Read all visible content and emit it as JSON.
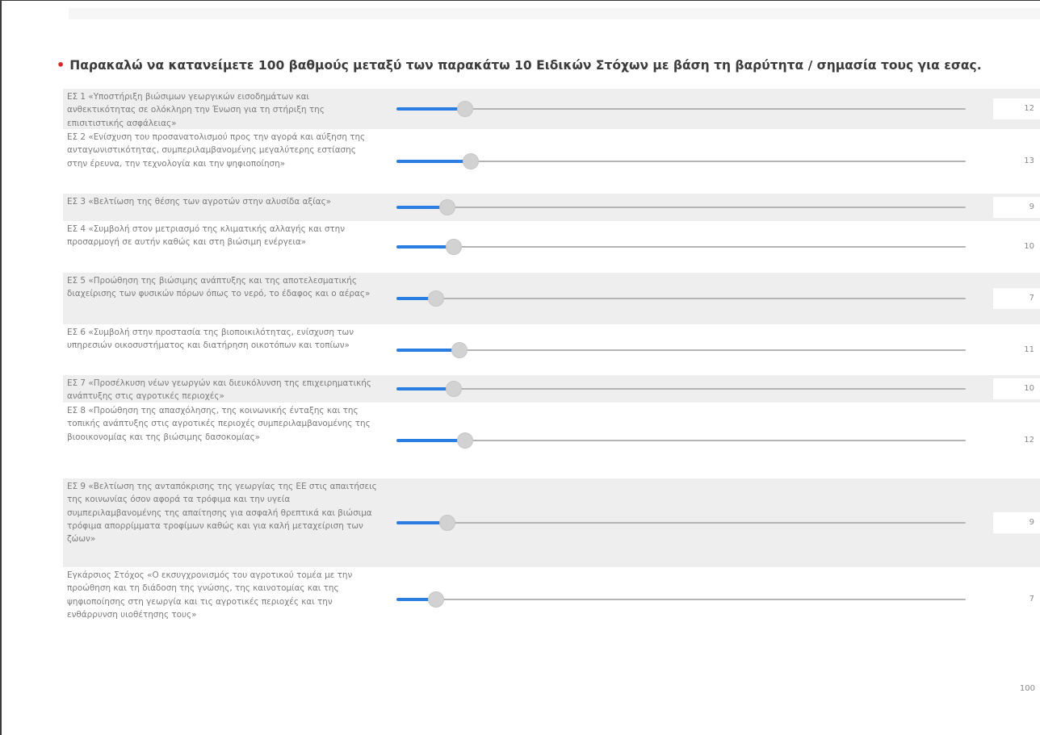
{
  "question": {
    "required_marker": "•",
    "text": "Παρακαλώ να κατανείμετε 100 βαθμούς μεταξύ των παρακάτω 10 Ειδικών Στόχων με βάση τη βαρύτητα / σημασία τους για εσας."
  },
  "slider_range": {
    "min": 0,
    "max": 100
  },
  "colors": {
    "fill": "#2a7de1",
    "required": "#e0242a"
  },
  "rows": [
    {
      "label": "ΕΣ 1 «Υποστήριξη βιώσιμων γεωργικών εισοδημάτων και ανθεκτικότητας σε ολόκληρη την Ένωση για τη στήριξη της επισιτιστικής ασφάλειας»",
      "value": 12
    },
    {
      "label": "ΕΣ 2 «Ενίσχυση του προσανατολισμού προς την αγορά και αύξηση της ανταγωνιστικότητας, συμπεριλαμβανομένης μεγαλύτερης εστίασης στην έρευνα, την τεχνολογία και την ψηφιοποίηση»",
      "value": 13
    },
    {
      "label": "ΕΣ 3 «Βελτίωση της θέσης των αγροτών στην αλυσίδα αξίας»",
      "value": 9
    },
    {
      "label": "ΕΣ 4 «Συμβολή στον μετριασμό της κλιματικής αλλαγής και στην προσαρμογή σε αυτήν καθώς και στη βιώσιμη ενέργεια»",
      "value": 10
    },
    {
      "label": "ΕΣ 5 «Προώθηση της βιώσιμης ανάπτυξης και της αποτελεσματικής διαχείρισης των φυσικών πόρων όπως το νερό, το έδαφος και ο αέρας»",
      "value": 7
    },
    {
      "label": "ΕΣ 6 «Συμβολή στην προστασία της βιοποικιλότητας, ενίσχυση των υπηρεσιών οικοσυστήματος και διατήρηση οικοτόπων και τοπίων»",
      "value": 11
    },
    {
      "label": "ΕΣ 7 «Προσέλκυση νέων γεωργών και διευκόλυνση της επιχειρηματικής ανάπτυξης στις αγροτικές περιοχές»",
      "value": 10
    },
    {
      "label": "ΕΣ 8 «Προώθηση της απασχόλησης, της κοινωνικής ένταξης και της τοπικής  ανάπτυξης στις αγροτικές περιοχές συμπεριλαμβανομένης της βιοοικονομίας και της βιώσιμης δασοκομίας»",
      "value": 12
    },
    {
      "label": "ΕΣ 9 «Βελτίωση της ανταπόκρισης της γεωργίας της ΕΕ στις απαιτήσεις της κοινωνίας όσον αφορά τα τρόφιμα και την υγεία συμπεριλαμβανομένης της απαίτησης για ασφαλή θρεπτικά και βιώσιμα τρόφιμα απορρίμματα τροφίμων καθώς και για καλή μεταχείριση των ζώων»",
      "value": 9
    },
    {
      "label": "Εγκάρσιος Στόχος «Ο εκσυγχρονισμός του αγροτικού τομέα με την προώθηση και τη διάδοση της γνώσης, της καινοτομίας και της ψηφιοποίησης στη γεωργία και τις αγροτικές περιοχές και την ενθάρρυνση υιοθέτησης τους»",
      "value": 7
    }
  ],
  "total": "100"
}
